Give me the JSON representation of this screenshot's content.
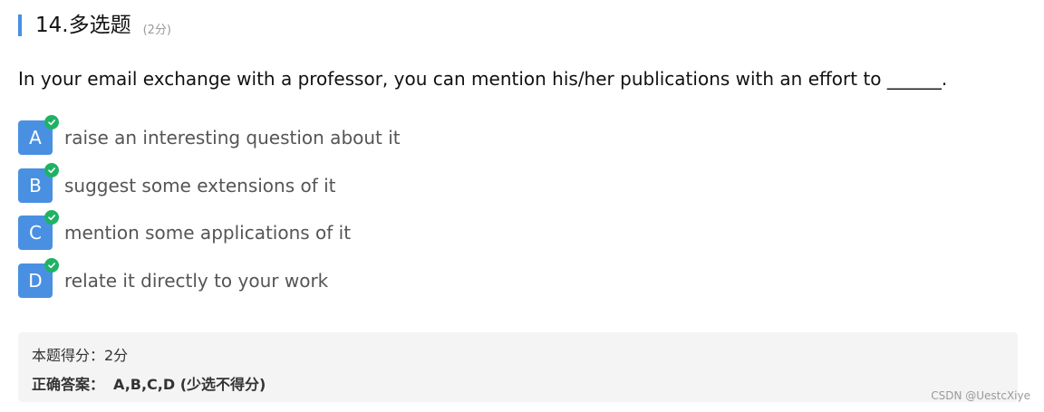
{
  "question": {
    "title": "14.多选题",
    "points": "(2分)",
    "stem": "In your email exchange with a professor, you can mention his/her publications with an effort to ______."
  },
  "options": [
    {
      "letter": "A",
      "text": "raise an interesting question about it",
      "selected": true
    },
    {
      "letter": "B",
      "text": "suggest some extensions of it",
      "selected": true
    },
    {
      "letter": "C",
      "text": "mention some applications of it",
      "selected": true
    },
    {
      "letter": "D",
      "text": "relate it directly to your work",
      "selected": true
    }
  ],
  "result": {
    "score_label": "本题得分：2分",
    "answer_label": "正确答案：",
    "answer_value": "A,B,C,D (少选不得分)"
  },
  "watermark": "CSDN @UestcXiye",
  "colors": {
    "accent": "#4a90e2",
    "check": "#1fb265",
    "result_bg": "#f4f4f4"
  },
  "icons": {
    "check": "check-circle-icon"
  }
}
